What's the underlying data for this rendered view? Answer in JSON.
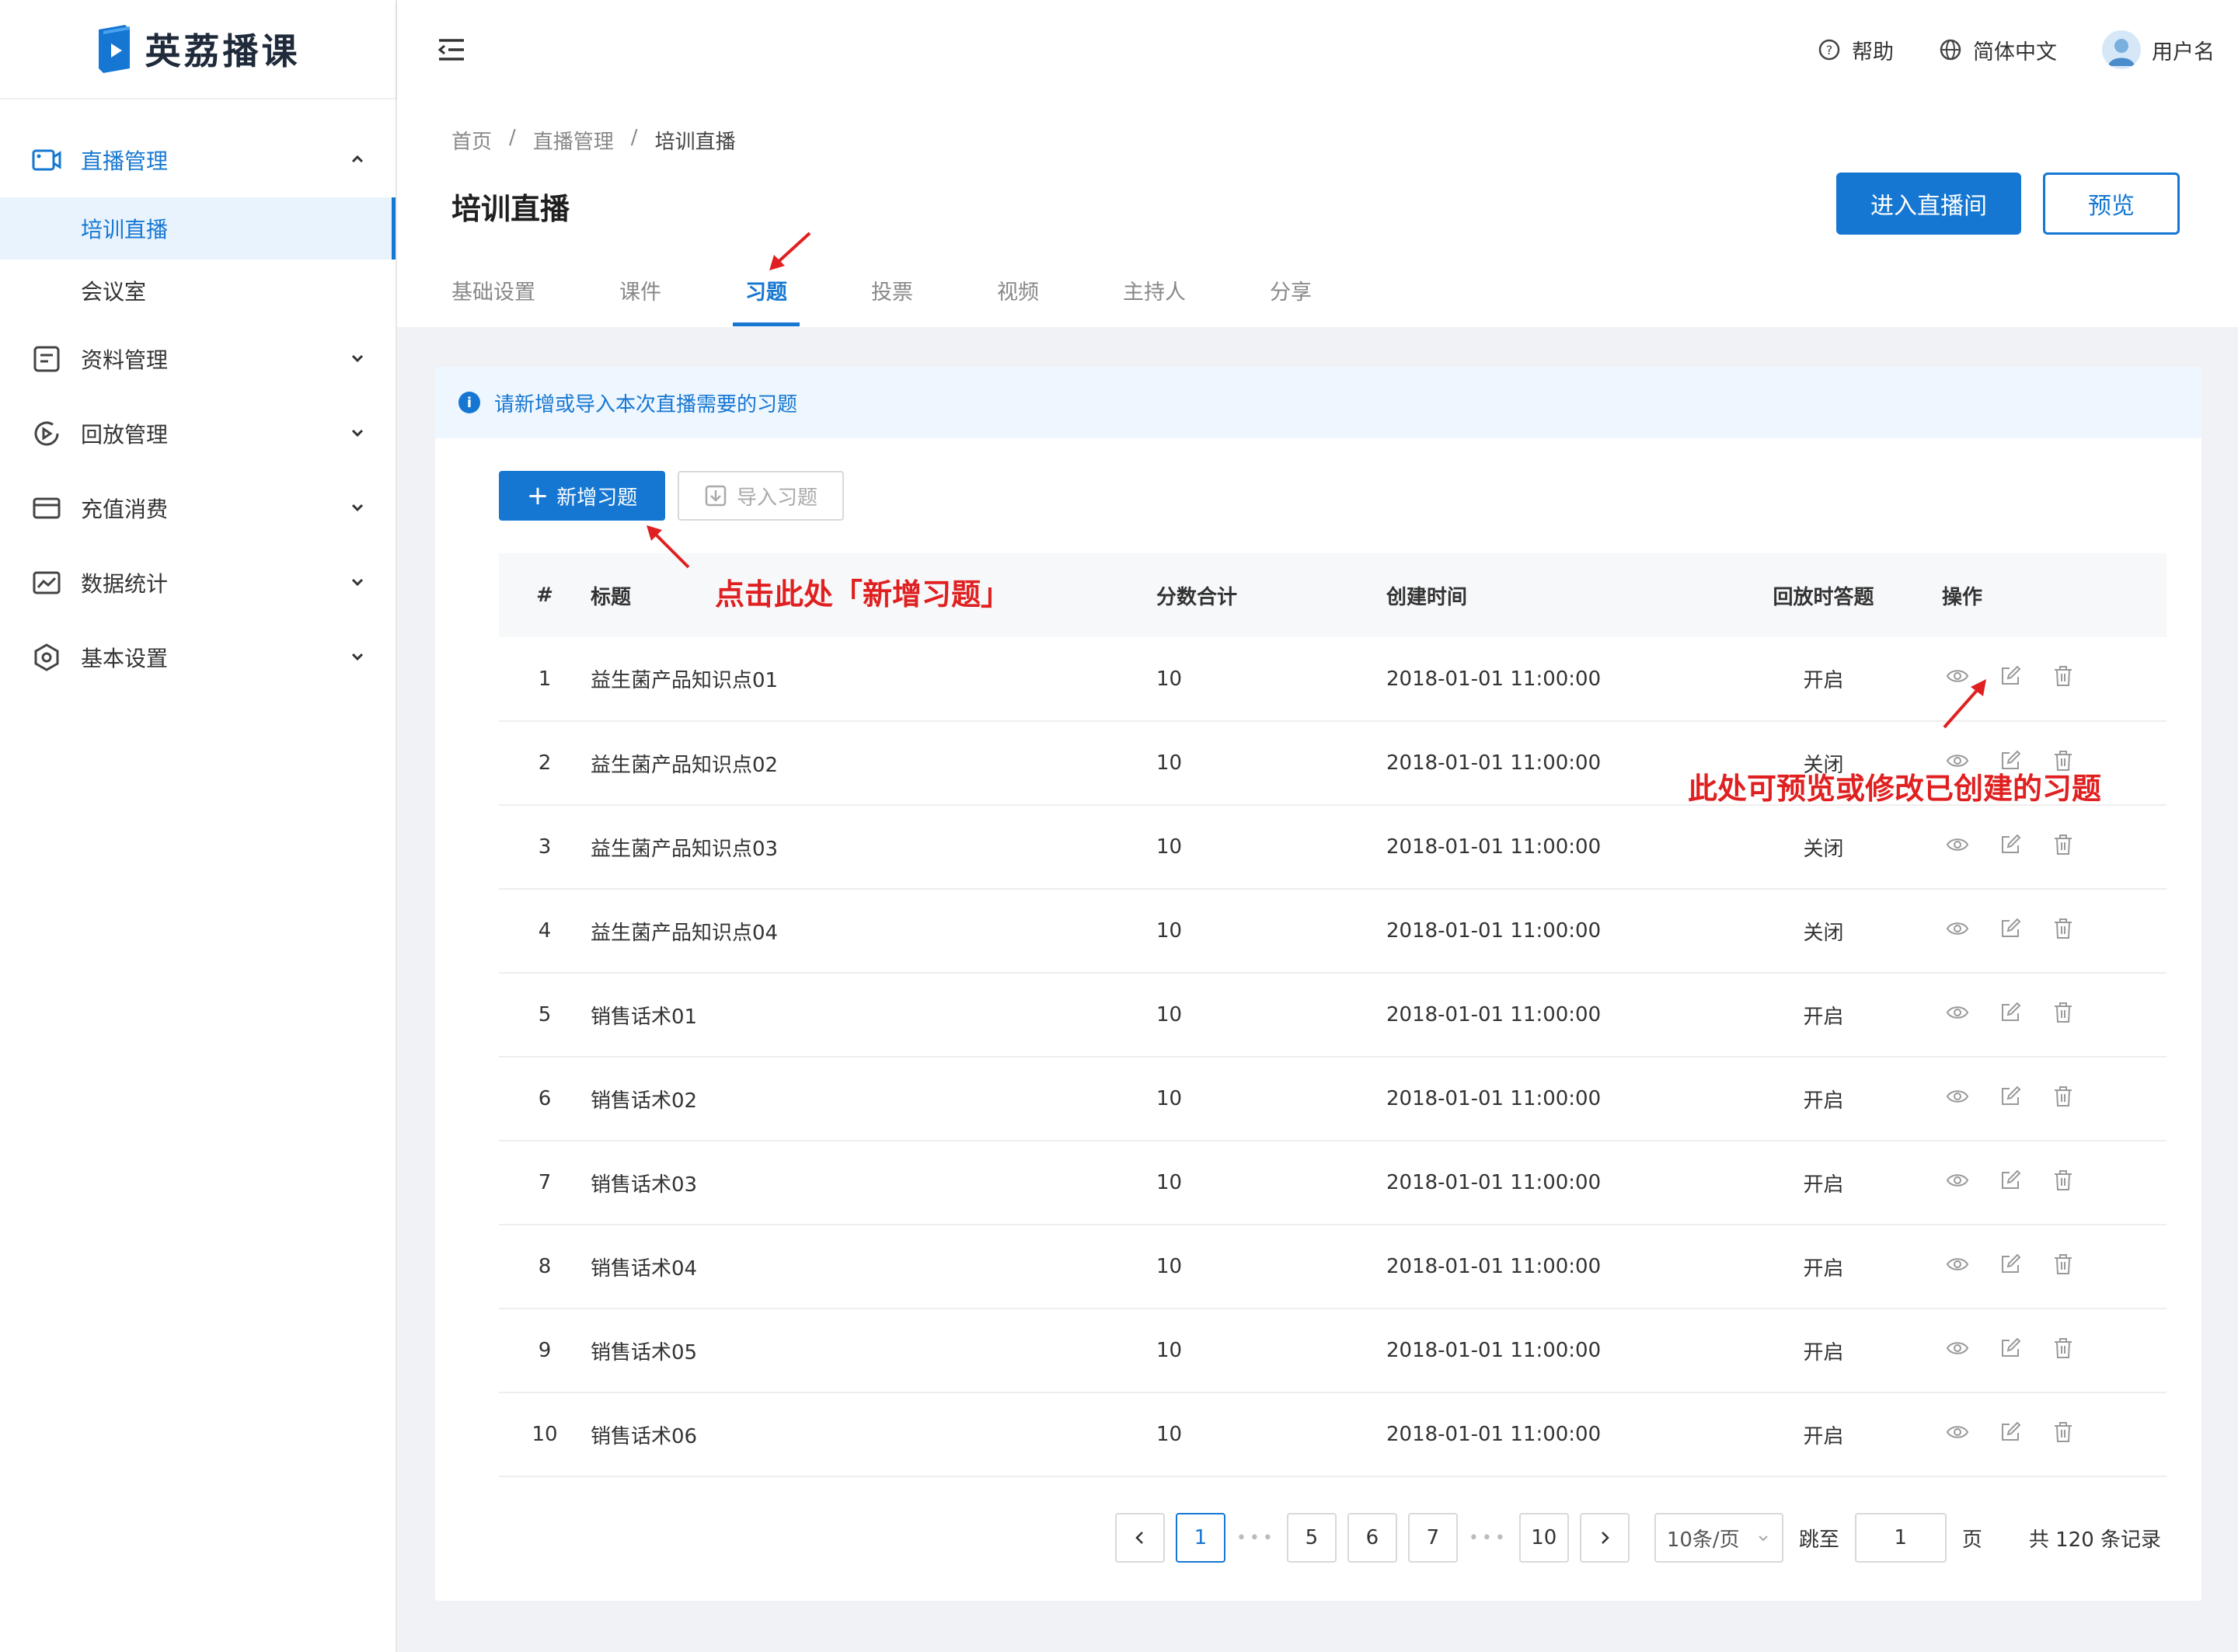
{
  "brand": {
    "name": "英荔播课",
    "logo_color": "#1677d2"
  },
  "header": {
    "help": "帮助",
    "language": "简体中文",
    "username": "用户名"
  },
  "sidebar": {
    "groups": [
      {
        "label": "直播管理",
        "icon": "video-camera-icon",
        "open": true,
        "children": [
          {
            "label": "培训直播",
            "active": true
          },
          {
            "label": "会议室",
            "active": false
          }
        ]
      },
      {
        "label": "资料管理",
        "icon": "document-icon"
      },
      {
        "label": "回放管理",
        "icon": "replay-icon"
      },
      {
        "label": "充值消费",
        "icon": "wallet-icon"
      },
      {
        "label": "数据统计",
        "icon": "chart-icon"
      },
      {
        "label": "基本设置",
        "icon": "settings-icon"
      }
    ]
  },
  "breadcrumb": [
    "首页",
    "直播管理",
    "培训直播"
  ],
  "page": {
    "title": "培训直播",
    "enter_button": "进入直播间",
    "preview_button": "预览"
  },
  "tabs": [
    "基础设置",
    "课件",
    "习题",
    "投票",
    "视频",
    "主持人",
    "分享"
  ],
  "active_tab": "习题",
  "alert": "请新增或导入本次直播需要的习题",
  "toolbar": {
    "add": "新增习题",
    "import": "导入习题"
  },
  "table": {
    "columns": [
      "#",
      "标题",
      "分数合计",
      "创建时间",
      "回放时答题",
      "操作"
    ],
    "rows": [
      {
        "num": "1",
        "title": "益生菌产品知识点01",
        "score": "10",
        "created": "2018-01-01 11:00:00",
        "replay": "开启"
      },
      {
        "num": "2",
        "title": "益生菌产品知识点02",
        "score": "10",
        "created": "2018-01-01 11:00:00",
        "replay": "关闭"
      },
      {
        "num": "3",
        "title": "益生菌产品知识点03",
        "score": "10",
        "created": "2018-01-01 11:00:00",
        "replay": "关闭"
      },
      {
        "num": "4",
        "title": "益生菌产品知识点04",
        "score": "10",
        "created": "2018-01-01 11:00:00",
        "replay": "关闭"
      },
      {
        "num": "5",
        "title": "销售话术01",
        "score": "10",
        "created": "2018-01-01 11:00:00",
        "replay": "开启"
      },
      {
        "num": "6",
        "title": "销售话术02",
        "score": "10",
        "created": "2018-01-01 11:00:00",
        "replay": "开启"
      },
      {
        "num": "7",
        "title": "销售话术03",
        "score": "10",
        "created": "2018-01-01 11:00:00",
        "replay": "开启"
      },
      {
        "num": "8",
        "title": "销售话术04",
        "score": "10",
        "created": "2018-01-01 11:00:00",
        "replay": "开启"
      },
      {
        "num": "9",
        "title": "销售话术05",
        "score": "10",
        "created": "2018-01-01 11:00:00",
        "replay": "开启"
      },
      {
        "num": "10",
        "title": "销售话术06",
        "score": "10",
        "created": "2018-01-01 11:00:00",
        "replay": "开启"
      }
    ],
    "row_actions": [
      "eye-icon",
      "edit-icon",
      "trash-icon"
    ]
  },
  "pagination": {
    "pages": [
      "1",
      "5",
      "6",
      "7",
      "10"
    ],
    "current": "1",
    "page_size": "10条/页",
    "jump_label": "跳至",
    "jump_value": "1",
    "page_unit": "页",
    "total": "共 120 条记录"
  },
  "annotations": {
    "add_hint": "点击此处「新增习题」",
    "action_hint": "此处可预览或修改已创建的习题",
    "color": "#e02020"
  }
}
